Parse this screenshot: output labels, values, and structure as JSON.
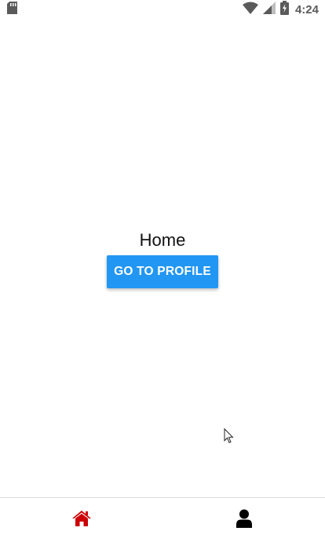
{
  "status_bar": {
    "time": "4:24",
    "icons": [
      "sd-card-icon",
      "wifi-icon",
      "cell-signal-icon",
      "battery-charging-icon"
    ]
  },
  "main": {
    "title": "Home",
    "button_label": "GO TO PROFILE"
  },
  "tab_bar": {
    "tabs": [
      {
        "icon": "home-icon",
        "active": true,
        "color": "#cc0000"
      },
      {
        "icon": "user-icon",
        "active": false,
        "color": "#000000"
      }
    ]
  },
  "colors": {
    "accent": "#2196f3",
    "active_tab": "#cc0000",
    "inactive_tab": "#000000"
  }
}
